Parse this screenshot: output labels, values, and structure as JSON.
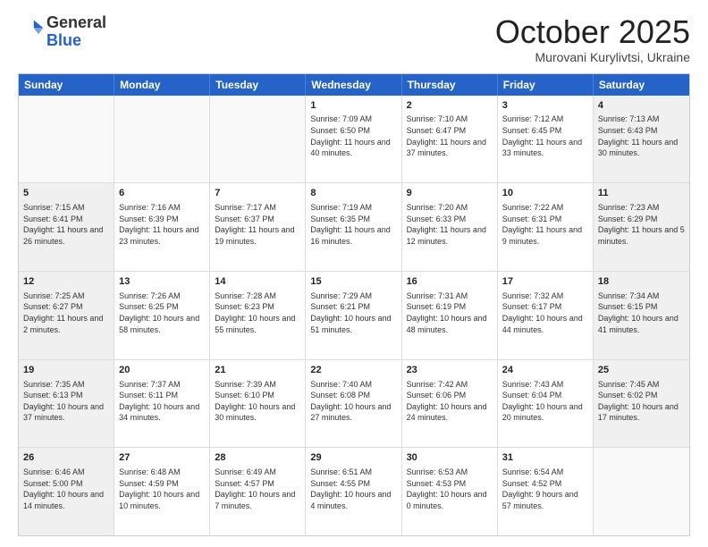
{
  "header": {
    "logo_general": "General",
    "logo_blue": "Blue",
    "month_title": "October 2025",
    "location": "Murovani Kurylivtsi, Ukraine"
  },
  "days_of_week": [
    "Sunday",
    "Monday",
    "Tuesday",
    "Wednesday",
    "Thursday",
    "Friday",
    "Saturday"
  ],
  "weeks": [
    [
      {
        "day": "",
        "text": "",
        "empty": true
      },
      {
        "day": "",
        "text": "",
        "empty": true
      },
      {
        "day": "",
        "text": "",
        "empty": true
      },
      {
        "day": "1",
        "text": "Sunrise: 7:09 AM\nSunset: 6:50 PM\nDaylight: 11 hours and 40 minutes."
      },
      {
        "day": "2",
        "text": "Sunrise: 7:10 AM\nSunset: 6:47 PM\nDaylight: 11 hours and 37 minutes."
      },
      {
        "day": "3",
        "text": "Sunrise: 7:12 AM\nSunset: 6:45 PM\nDaylight: 11 hours and 33 minutes."
      },
      {
        "day": "4",
        "text": "Sunrise: 7:13 AM\nSunset: 6:43 PM\nDaylight: 11 hours and 30 minutes.",
        "shaded": true
      }
    ],
    [
      {
        "day": "5",
        "text": "Sunrise: 7:15 AM\nSunset: 6:41 PM\nDaylight: 11 hours and 26 minutes.",
        "shaded": true
      },
      {
        "day": "6",
        "text": "Sunrise: 7:16 AM\nSunset: 6:39 PM\nDaylight: 11 hours and 23 minutes."
      },
      {
        "day": "7",
        "text": "Sunrise: 7:17 AM\nSunset: 6:37 PM\nDaylight: 11 hours and 19 minutes."
      },
      {
        "day": "8",
        "text": "Sunrise: 7:19 AM\nSunset: 6:35 PM\nDaylight: 11 hours and 16 minutes."
      },
      {
        "day": "9",
        "text": "Sunrise: 7:20 AM\nSunset: 6:33 PM\nDaylight: 11 hours and 12 minutes."
      },
      {
        "day": "10",
        "text": "Sunrise: 7:22 AM\nSunset: 6:31 PM\nDaylight: 11 hours and 9 minutes."
      },
      {
        "day": "11",
        "text": "Sunrise: 7:23 AM\nSunset: 6:29 PM\nDaylight: 11 hours and 5 minutes.",
        "shaded": true
      }
    ],
    [
      {
        "day": "12",
        "text": "Sunrise: 7:25 AM\nSunset: 6:27 PM\nDaylight: 11 hours and 2 minutes.",
        "shaded": true
      },
      {
        "day": "13",
        "text": "Sunrise: 7:26 AM\nSunset: 6:25 PM\nDaylight: 10 hours and 58 minutes."
      },
      {
        "day": "14",
        "text": "Sunrise: 7:28 AM\nSunset: 6:23 PM\nDaylight: 10 hours and 55 minutes."
      },
      {
        "day": "15",
        "text": "Sunrise: 7:29 AM\nSunset: 6:21 PM\nDaylight: 10 hours and 51 minutes."
      },
      {
        "day": "16",
        "text": "Sunrise: 7:31 AM\nSunset: 6:19 PM\nDaylight: 10 hours and 48 minutes."
      },
      {
        "day": "17",
        "text": "Sunrise: 7:32 AM\nSunset: 6:17 PM\nDaylight: 10 hours and 44 minutes."
      },
      {
        "day": "18",
        "text": "Sunrise: 7:34 AM\nSunset: 6:15 PM\nDaylight: 10 hours and 41 minutes.",
        "shaded": true
      }
    ],
    [
      {
        "day": "19",
        "text": "Sunrise: 7:35 AM\nSunset: 6:13 PM\nDaylight: 10 hours and 37 minutes.",
        "shaded": true
      },
      {
        "day": "20",
        "text": "Sunrise: 7:37 AM\nSunset: 6:11 PM\nDaylight: 10 hours and 34 minutes."
      },
      {
        "day": "21",
        "text": "Sunrise: 7:39 AM\nSunset: 6:10 PM\nDaylight: 10 hours and 30 minutes."
      },
      {
        "day": "22",
        "text": "Sunrise: 7:40 AM\nSunset: 6:08 PM\nDaylight: 10 hours and 27 minutes."
      },
      {
        "day": "23",
        "text": "Sunrise: 7:42 AM\nSunset: 6:06 PM\nDaylight: 10 hours and 24 minutes."
      },
      {
        "day": "24",
        "text": "Sunrise: 7:43 AM\nSunset: 6:04 PM\nDaylight: 10 hours and 20 minutes."
      },
      {
        "day": "25",
        "text": "Sunrise: 7:45 AM\nSunset: 6:02 PM\nDaylight: 10 hours and 17 minutes.",
        "shaded": true
      }
    ],
    [
      {
        "day": "26",
        "text": "Sunrise: 6:46 AM\nSunset: 5:00 PM\nDaylight: 10 hours and 14 minutes.",
        "shaded": true
      },
      {
        "day": "27",
        "text": "Sunrise: 6:48 AM\nSunset: 4:59 PM\nDaylight: 10 hours and 10 minutes."
      },
      {
        "day": "28",
        "text": "Sunrise: 6:49 AM\nSunset: 4:57 PM\nDaylight: 10 hours and 7 minutes."
      },
      {
        "day": "29",
        "text": "Sunrise: 6:51 AM\nSunset: 4:55 PM\nDaylight: 10 hours and 4 minutes."
      },
      {
        "day": "30",
        "text": "Sunrise: 6:53 AM\nSunset: 4:53 PM\nDaylight: 10 hours and 0 minutes."
      },
      {
        "day": "31",
        "text": "Sunrise: 6:54 AM\nSunset: 4:52 PM\nDaylight: 9 hours and 57 minutes."
      },
      {
        "day": "",
        "text": "",
        "empty": true
      }
    ]
  ]
}
